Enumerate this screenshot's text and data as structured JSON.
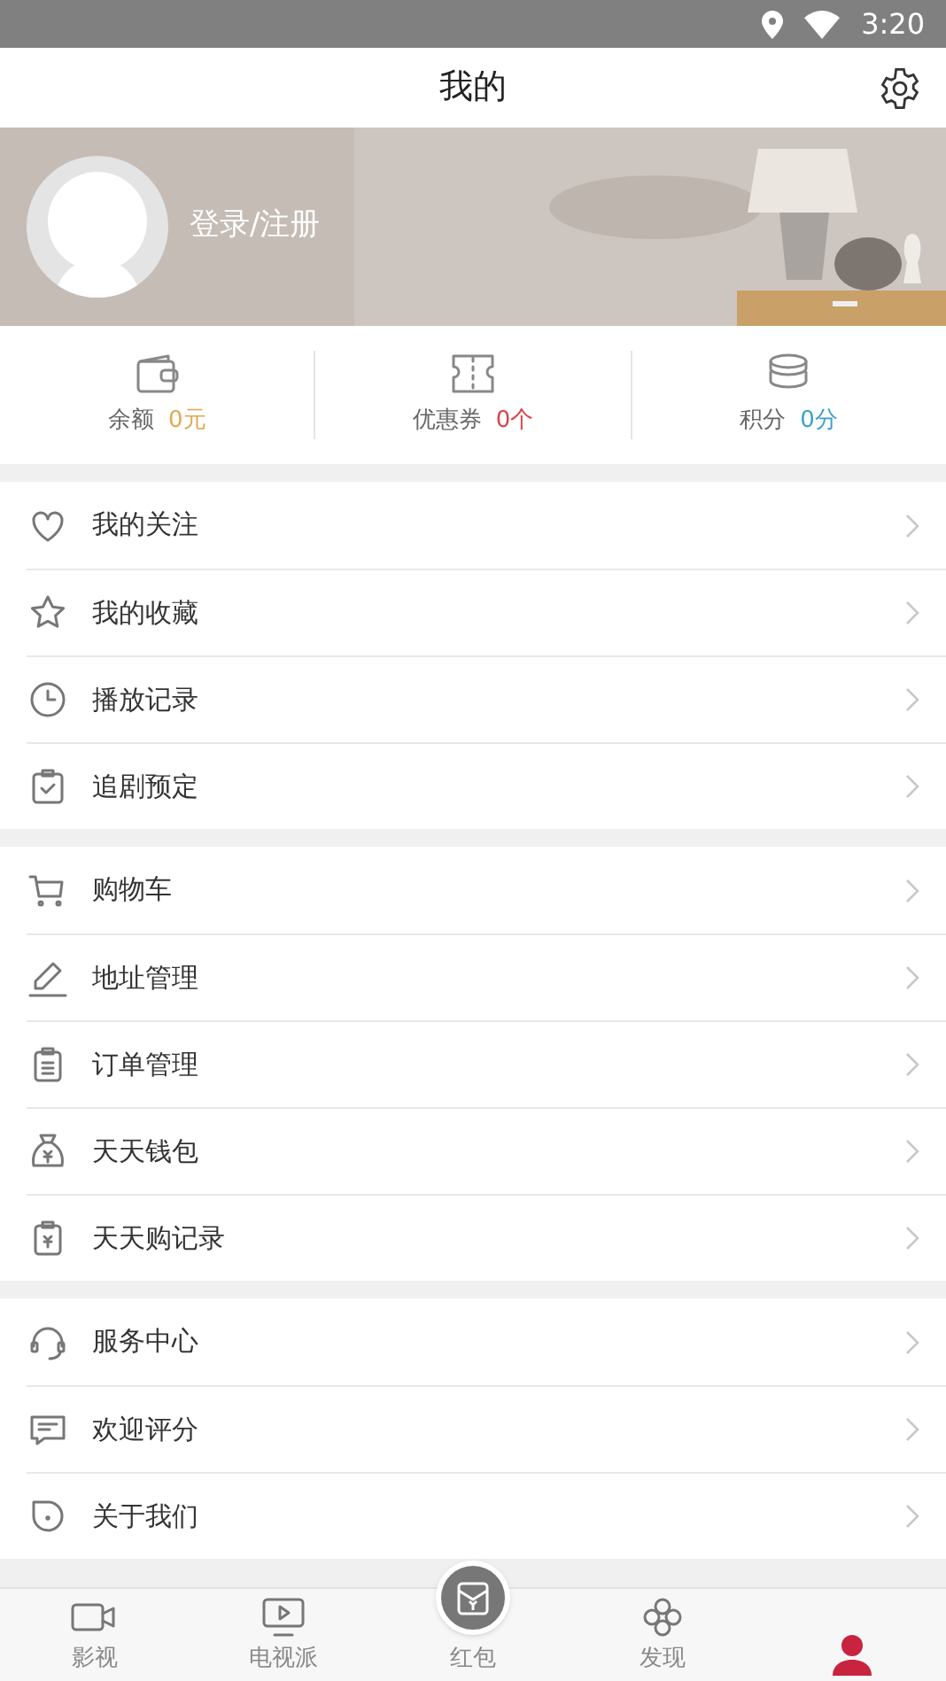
{
  "status_bar": {
    "time": "3:20"
  },
  "header": {
    "title": "我的"
  },
  "profile": {
    "login": "登录/注册"
  },
  "stats": [
    {
      "kind": "wallet",
      "label": "余额",
      "value": "0元",
      "color": "#e0a852"
    },
    {
      "kind": "coupon",
      "label": "优惠券",
      "value": "0个",
      "color": "#d9434b"
    },
    {
      "kind": "coins",
      "label": "积分",
      "value": "0分",
      "color": "#3aa0c8"
    }
  ],
  "menu_groups": [
    [
      {
        "kind": "heart",
        "label": "我的关注"
      },
      {
        "kind": "star",
        "label": "我的收藏"
      },
      {
        "kind": "clock",
        "label": "播放记录"
      },
      {
        "kind": "clipboard-check",
        "label": "追剧预定"
      }
    ],
    [
      {
        "kind": "cart",
        "label": "购物车"
      },
      {
        "kind": "pencil",
        "label": "地址管理"
      },
      {
        "kind": "clipboard",
        "label": "订单管理"
      },
      {
        "kind": "moneybag",
        "label": "天天钱包"
      },
      {
        "kind": "receipt",
        "label": "天天购记录"
      }
    ],
    [
      {
        "kind": "headset",
        "label": "服务中心"
      },
      {
        "kind": "message",
        "label": "欢迎评分"
      },
      {
        "kind": "info",
        "label": "关于我们"
      }
    ]
  ],
  "tabs": [
    {
      "kind": "video",
      "label": "影视",
      "selected": false
    },
    {
      "kind": "tv",
      "label": "电视派",
      "selected": false
    },
    {
      "kind": "envelope",
      "label": "红包",
      "selected": false
    },
    {
      "kind": "clover",
      "label": "发现",
      "selected": false
    },
    {
      "kind": "person",
      "selected": true
    }
  ]
}
